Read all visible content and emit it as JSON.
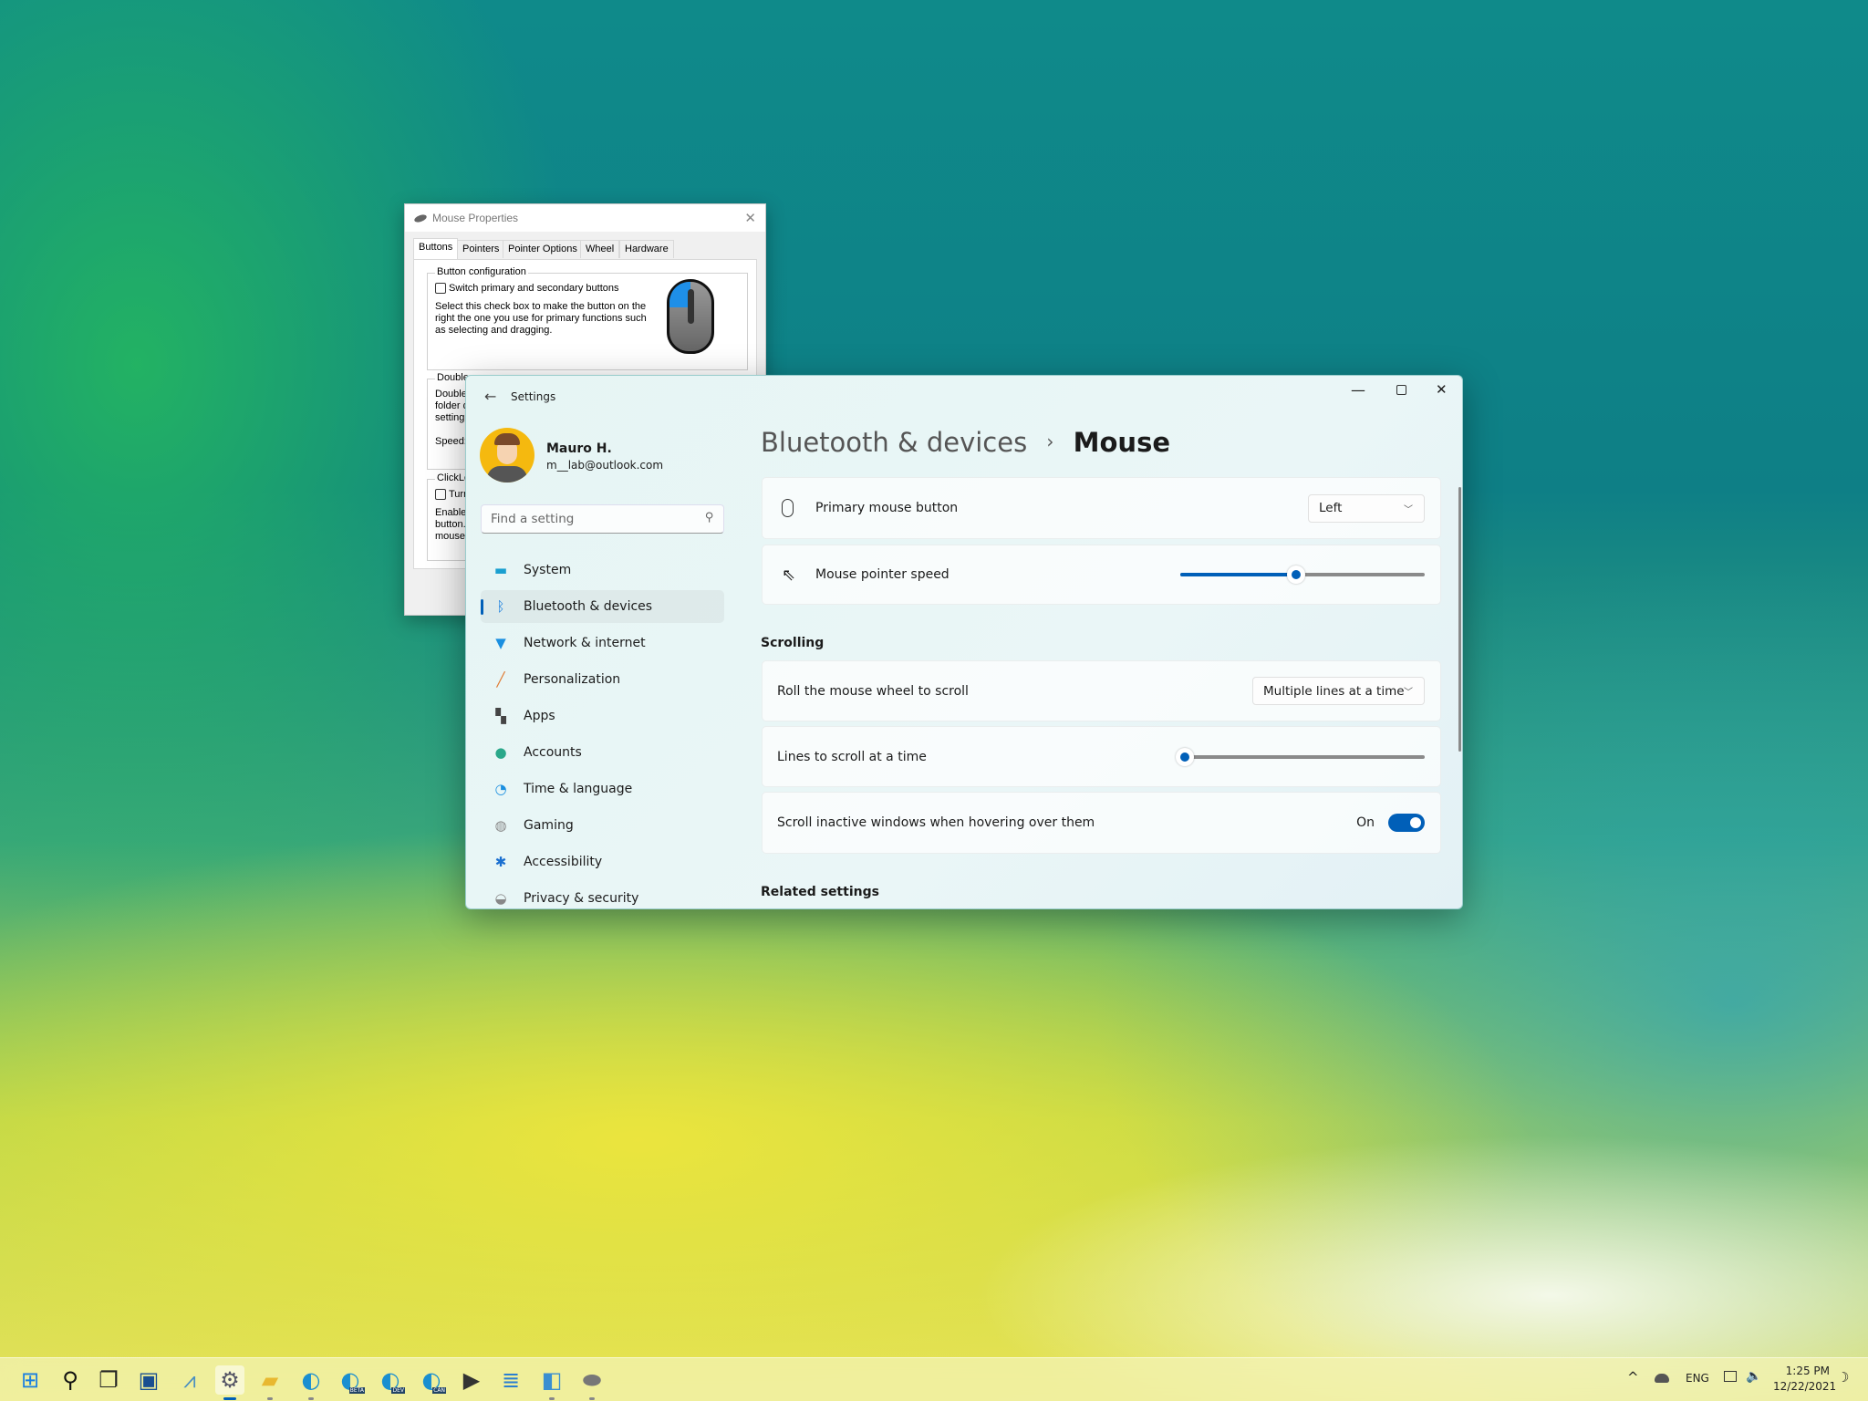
{
  "mouse_properties": {
    "title": "Mouse Properties",
    "tabs": [
      "Buttons",
      "Pointers",
      "Pointer Options",
      "Wheel",
      "Hardware"
    ],
    "active_tab": "Buttons",
    "button_config": {
      "legend": "Button configuration",
      "checkbox_label": "Switch primary and secondary buttons",
      "checked": false,
      "description": "Select this check box to make the button on the right the one you use for primary functions such as selecting and dragging."
    },
    "double_click": {
      "legend": "Double-",
      "text": "Double-\nfolder d\nsetting.",
      "speed_label": "Speed:"
    },
    "clicklock": {
      "legend": "ClickLoc",
      "checkbox_label": "Turn",
      "text": "Enables\nbutton.\nmouse b"
    }
  },
  "settings": {
    "title": "Settings",
    "user": {
      "name": "Mauro H.",
      "email": "m__lab@outlook.com"
    },
    "search_placeholder": "Find a setting",
    "nav": [
      {
        "label": "System",
        "icon": "system-icon"
      },
      {
        "label": "Bluetooth & devices",
        "icon": "bluetooth-icon",
        "selected": true
      },
      {
        "label": "Network & internet",
        "icon": "wifi-icon"
      },
      {
        "label": "Personalization",
        "icon": "brush-icon"
      },
      {
        "label": "Apps",
        "icon": "apps-icon"
      },
      {
        "label": "Accounts",
        "icon": "person-icon"
      },
      {
        "label": "Time & language",
        "icon": "clock-globe-icon"
      },
      {
        "label": "Gaming",
        "icon": "gamepad-icon"
      },
      {
        "label": "Accessibility",
        "icon": "accessibility-icon"
      },
      {
        "label": "Privacy & security",
        "icon": "shield-icon"
      }
    ],
    "breadcrumb": {
      "parent": "Bluetooth & devices",
      "separator": "›",
      "current": "Mouse"
    },
    "primary_button": {
      "label": "Primary mouse button",
      "value": "Left"
    },
    "pointer_speed": {
      "label": "Mouse pointer speed",
      "value": 10,
      "min": 1,
      "max": 20
    },
    "scrolling_header": "Scrolling",
    "roll_wheel": {
      "label": "Roll the mouse wheel to scroll",
      "value": "Multiple lines at a time"
    },
    "lines_to_scroll": {
      "label": "Lines to scroll at a time",
      "value": 3,
      "min": 1,
      "max": 100
    },
    "scroll_inactive": {
      "label": "Scroll inactive windows when hovering over them",
      "state": "On",
      "on": true
    },
    "related_header": "Related settings",
    "accent": "#005fb8"
  },
  "taskbar": {
    "icons": [
      "start-icon",
      "search-icon",
      "task-view-icon",
      "store-icon",
      "performance-monitor-icon",
      "settings-icon",
      "file-explorer-icon",
      "edge-icon",
      "edge-beta-icon",
      "edge-dev-icon",
      "edge-canary-icon",
      "terminal-icon",
      "notepad-icon",
      "control-panel-icon",
      "mouse-icon"
    ],
    "badges": {
      "edge-beta-icon": "BETA",
      "edge-dev-icon": "DEV",
      "edge-canary-icon": "CAN"
    },
    "tray": {
      "language": "ENG",
      "time": "1:25 PM",
      "date": "12/22/2021"
    }
  }
}
